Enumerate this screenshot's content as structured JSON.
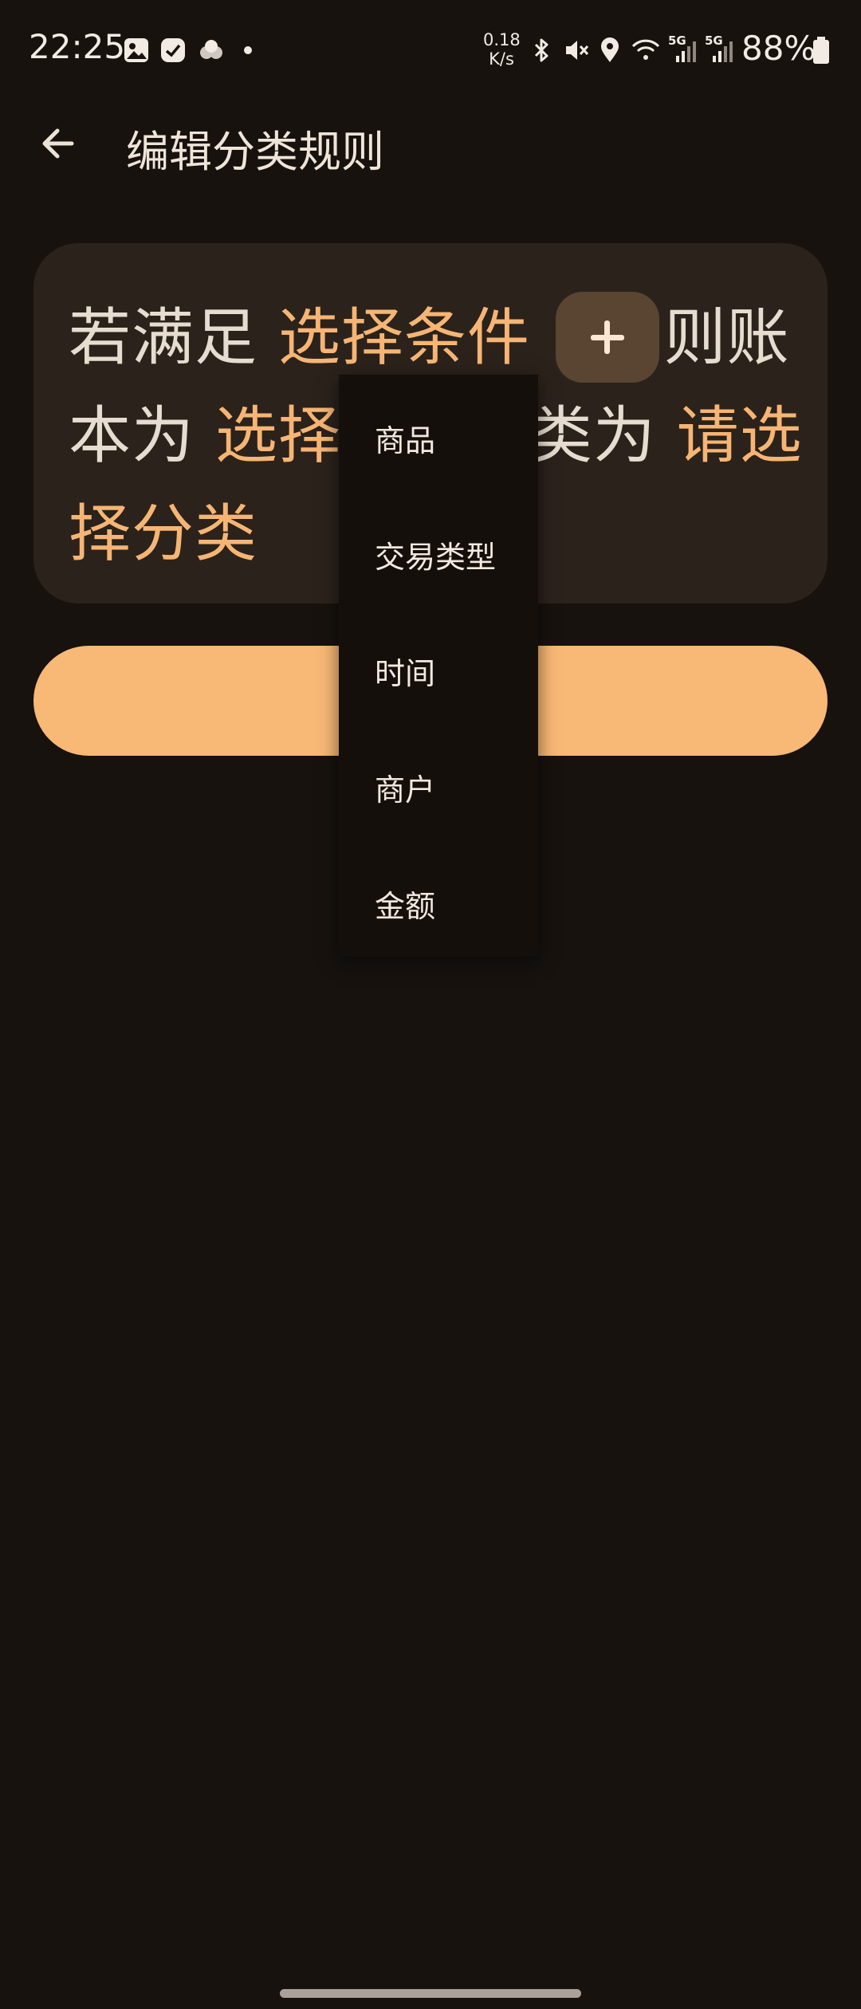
{
  "status_bar": {
    "time": "22:25",
    "net_speed_value": "0.18",
    "net_speed_unit": "K/s",
    "signal_label_1": "5G",
    "signal_label_2": "5G",
    "battery": "88%",
    "icons": [
      "gallery-icon",
      "calendar-icon",
      "cloud-icon",
      "dot-icon",
      "bluetooth-icon",
      "mute-icon",
      "location-icon",
      "wifi-icon",
      "signal-icon",
      "signal-icon",
      "battery-icon"
    ]
  },
  "app_bar": {
    "title": "编辑分类规则",
    "back_icon": "arrow-left-icon"
  },
  "rule": {
    "prefix": "若满足",
    "condition_placeholder": "选择条件",
    "then_text": "则账",
    "line2_start": "本为",
    "book_placeholder": "选择账本",
    "category_text": "分类为",
    "category_placeholder": "请选择分类"
  },
  "save_button": {
    "label": ""
  },
  "menu": {
    "items": [
      "商品",
      "交易类型",
      "时间",
      "商户",
      "金额"
    ]
  },
  "colors": {
    "background": "#17120e",
    "accent": "#f6b574",
    "card": "#2b221b",
    "chip": "#5a4533"
  }
}
